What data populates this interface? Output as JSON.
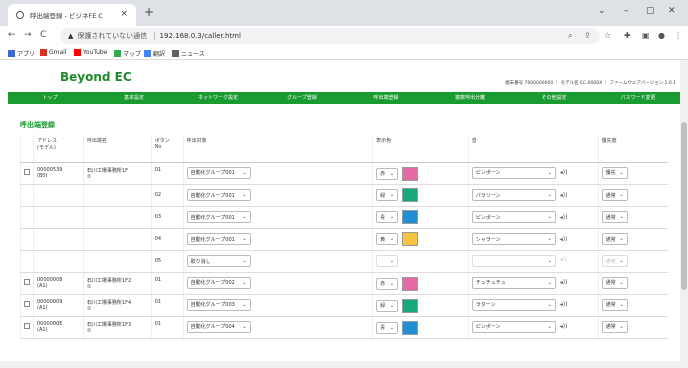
{
  "browser": {
    "tab_title": "呼出端登録 - ビジネFE C",
    "close_glyph": "×",
    "newtab_glyph": "+",
    "win_controls": [
      "⌄",
      "–",
      "▢",
      "✕"
    ],
    "back": "←",
    "forward": "→",
    "reload": "C",
    "security_label": "保護されていない通信",
    "url": "192.168.0.3/caller.html",
    "toolbar_icons": [
      "search-icon",
      "share-icon",
      "star-icon",
      "extension-icon",
      "sidebar-icon",
      "profile-icon",
      "menu-icon"
    ],
    "bookmarks": [
      {
        "label": "アプリ",
        "color": "#3b66d6"
      },
      {
        "label": "Gmail",
        "color": "#d93025"
      },
      {
        "label": "YouTube",
        "color": "#ff0000"
      },
      {
        "label": "マップ",
        "color": "#34a853"
      },
      {
        "label": "翻訳",
        "color": "#4285f4"
      },
      {
        "label": "ニュース",
        "color": "#5f6368"
      }
    ]
  },
  "page": {
    "logo": "Beyond EC",
    "header_info": "端末番号 7000000000 ｜ モデル名 EC-0000X ｜ ファームウェアバージョン 1.0.1",
    "menu": [
      "トップ",
      "基本設定",
      "ネットワーク設定",
      "グループ登録",
      "呼出端登録",
      "複数呼出分離",
      "その他設定",
      "パスワード変更"
    ],
    "title": "呼出端登録",
    "accent": "#1a9b2f",
    "columns": [
      "アドレス\n(モデル)",
      "呼出端名",
      "ボタン\nNo",
      "呼出対象",
      "表示色",
      "音",
      "優先度"
    ],
    "rows": [
      {
        "address": "00000539\n(B0)",
        "name": "石川工場事務所1F\n①",
        "no": "01",
        "target": "自動化グループ001",
        "color_label": "赤",
        "color_hex": "#e36aa2",
        "sound": "ピンポーン",
        "priority": "優先",
        "checkbox": true
      },
      {
        "address": "",
        "name": "",
        "no": "02",
        "target": "自動化グループ001",
        "color_label": "緑",
        "color_hex": "#17a77c",
        "sound": "パラリーン",
        "priority": "通常",
        "checkbox": false
      },
      {
        "address": "",
        "name": "",
        "no": "03",
        "target": "自動化グループ001",
        "color_label": "青",
        "color_hex": "#1f8fd6",
        "sound": "ピンポーン",
        "priority": "通常",
        "checkbox": false
      },
      {
        "address": "",
        "name": "",
        "no": "04",
        "target": "自動化グループ001",
        "color_label": "黄",
        "color_hex": "#f4c542",
        "sound": "シャラーン",
        "priority": "通常",
        "checkbox": false
      },
      {
        "address": "",
        "name": "",
        "no": "05",
        "target": "取り消し",
        "color_label": "",
        "color_hex": "",
        "sound": "",
        "priority": "通常",
        "checkbox": false,
        "disabled": true
      },
      {
        "address": "00000008\n(A1)",
        "name": "石川工場事務所1F2\n①",
        "no": "01",
        "target": "自動化グループ002",
        "color_label": "赤",
        "color_hex": "#e36aa2",
        "sound": "チュチュチュ",
        "priority": "通常",
        "checkbox": true
      },
      {
        "address": "00000009\n(A1)",
        "name": "石川工場事務所1F4\n①",
        "no": "01",
        "target": "自動化グループ003",
        "color_label": "緑",
        "color_hex": "#17a77c",
        "sound": "ラターン",
        "priority": "通常",
        "checkbox": true
      },
      {
        "address": "0000000E\n(A1)",
        "name": "石川工場事務所1F3\n①",
        "no": "01",
        "target": "自動化グループ004",
        "color_label": "青",
        "color_hex": "#1f8fd6",
        "sound": "ピンポーン",
        "priority": "通常",
        "checkbox": true
      }
    ]
  }
}
